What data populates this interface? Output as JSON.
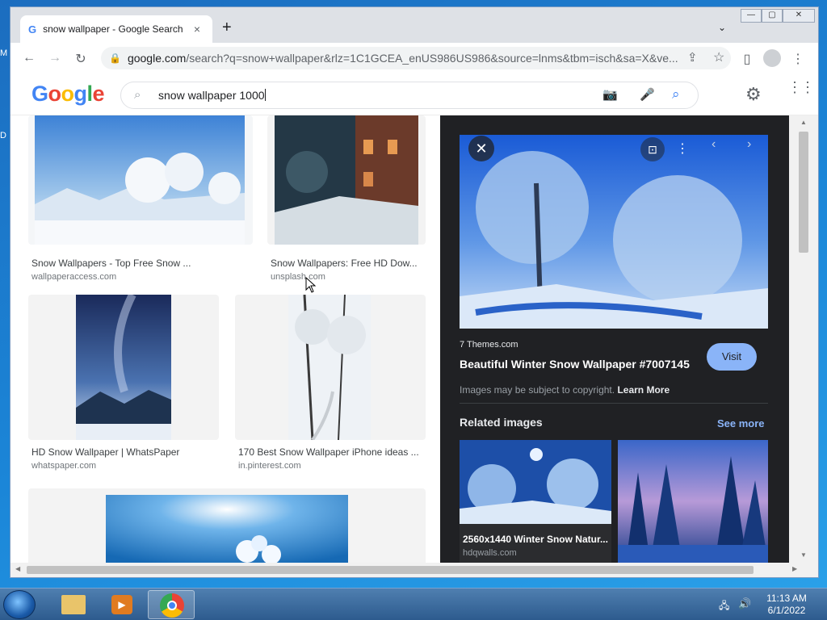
{
  "desktop": {
    "labels": [
      "M",
      "D"
    ]
  },
  "window": {
    "controls": [
      "—",
      "▢",
      "✕"
    ]
  },
  "tab": {
    "title": "snow wallpaper - Google Search",
    "close": "×",
    "new": "+"
  },
  "toolbar": {
    "url_host": "google.com",
    "url_rest": "/search?q=snow+wallpaper&rlz=1C1GCEA_enUS986US986&source=lnms&tbm=isch&sa=X&ve..."
  },
  "search": {
    "logo": "Google",
    "query": "snow wallpaper 1000"
  },
  "results": [
    {
      "title": "Snow Wallpapers - Top Free Snow ...",
      "site": "wallpaperaccess.com"
    },
    {
      "title": "Snow Wallpapers: Free HD Dow...",
      "site": "unsplash.com"
    },
    {
      "title": "HD Snow Wallpaper | WhatsPaper",
      "site": "whatspaper.com"
    },
    {
      "title": "170 Best Snow Wallpaper iPhone ideas ...",
      "site": "in.pinterest.com"
    }
  ],
  "panel": {
    "source": "7 Themes.com",
    "title": "Beautiful Winter Snow Wallpaper #7007145",
    "visit": "Visit",
    "copyright": "Images may be subject to copyright.",
    "learn_more": "Learn More",
    "related": "Related images",
    "see_more": "See more",
    "related_items": [
      {
        "title": "2560x1440 Winter Snow Natur...",
        "site": "hdqwalls.com"
      }
    ]
  },
  "taskbar": {
    "time": "11:13 AM",
    "date": "6/1/2022"
  },
  "colors": {
    "accent": "#8ab4f8",
    "panel_bg": "#202124",
    "desktop": "#1b86d8"
  }
}
